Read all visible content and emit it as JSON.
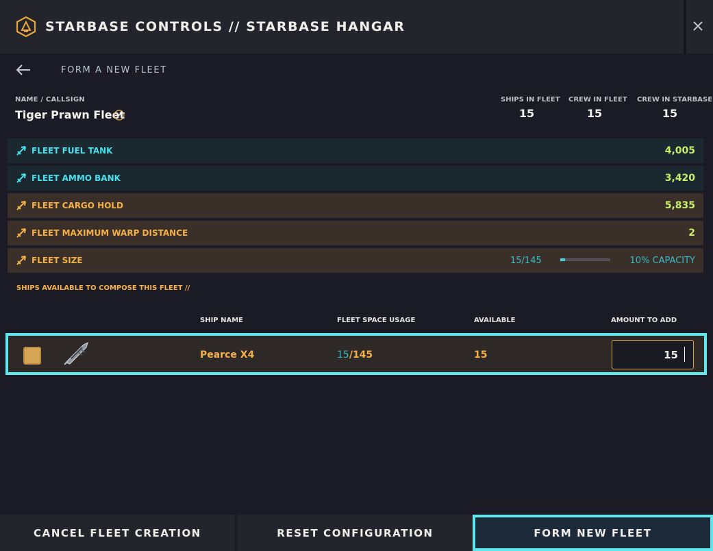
{
  "header": {
    "title": "STARBASE CONTROLS // STARBASE HANGAR",
    "logo_icon": "starbase-logo-icon",
    "close_icon": "close-icon"
  },
  "breadcrumb": {
    "label": "FORM A NEW FLEET",
    "back_icon": "arrow-left-icon"
  },
  "fleet": {
    "name_label": "NAME / CALLSIGN",
    "name": "Tiger Prawn Fleet",
    "stats": [
      {
        "label": "SHIPS IN FLEET",
        "value": "15"
      },
      {
        "label": "CREW IN FLEET",
        "value": "15"
      },
      {
        "label": "CREW IN STARBASE",
        "value": "15"
      }
    ]
  },
  "resources": [
    {
      "label": "FLEET FUEL TANK",
      "value": "4,005"
    },
    {
      "label": "FLEET AMMO BANK",
      "value": "3,420"
    },
    {
      "label": "FLEET CARGO HOLD",
      "value": "5,835"
    },
    {
      "label": "FLEET MAXIMUM WARP DISTANCE",
      "value": "2"
    }
  ],
  "fleet_size": {
    "label": "FLEET SIZE",
    "count": "15/145",
    "fraction": 0.1,
    "capacity": "10% CAPACITY"
  },
  "available": {
    "heading": "SHIPS AVAILABLE TO COMPOSE THIS FLEET //",
    "columns": [
      "SHIP NAME",
      "FLEET SPACE USAGE",
      "AVAILABLE",
      "AMOUNT TO ADD"
    ],
    "rows": [
      {
        "name": "Pearce X4",
        "usage_used": "15",
        "usage_total": "/145",
        "available": "15",
        "amount": "15"
      }
    ]
  },
  "footer": {
    "cancel": "CANCEL FLEET CREATION",
    "reset": "RESET CONFIGURATION",
    "form": "FORM NEW FLEET"
  },
  "colors": {
    "accent_cyan": "#5ee8ee",
    "accent_orange": "#f5b048",
    "value_green": "#c8ef6c"
  }
}
